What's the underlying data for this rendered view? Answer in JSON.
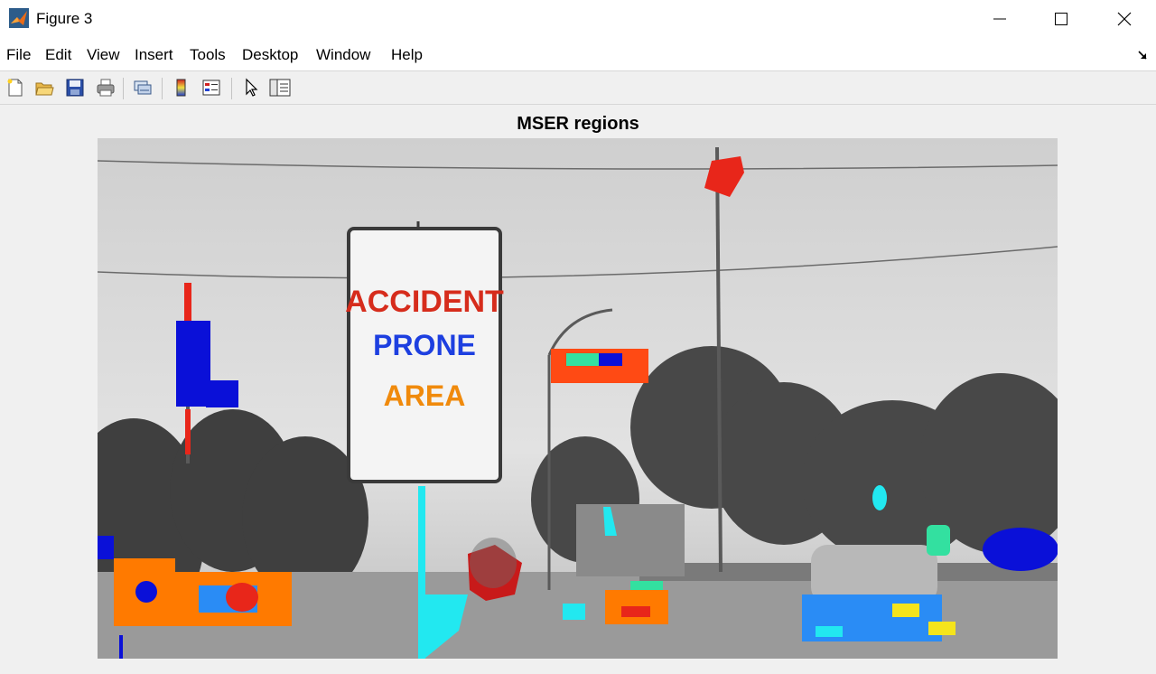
{
  "window": {
    "title": "Figure 3"
  },
  "menu": [
    "File",
    "Edit",
    "View",
    "Insert",
    "Tools",
    "Desktop",
    "Window",
    "Help"
  ],
  "toolbar": {
    "buttons": [
      "new-figure-icon",
      "open-file-icon",
      "save-icon",
      "print-icon",
      "link-plot-icon",
      "colorbar-icon",
      "legend-icon",
      "edit-plot-pointer-icon",
      "property-inspector-icon"
    ]
  },
  "figure": {
    "title": "MSER regions",
    "image": {
      "sign_lines": [
        "ACCIDENT",
        "PRONE",
        "AREA"
      ]
    }
  },
  "colors": {
    "titlebar_bg": "#ffffff",
    "figure_bg": "#f0f0f0",
    "mser_red": "#e8261a",
    "mser_blue": "#0a10d8",
    "mser_orange": "#ff7a00",
    "mser_cyan": "#22e8f0",
    "mser_yellow": "#f5e41c",
    "mser_green": "#33e0a0"
  }
}
